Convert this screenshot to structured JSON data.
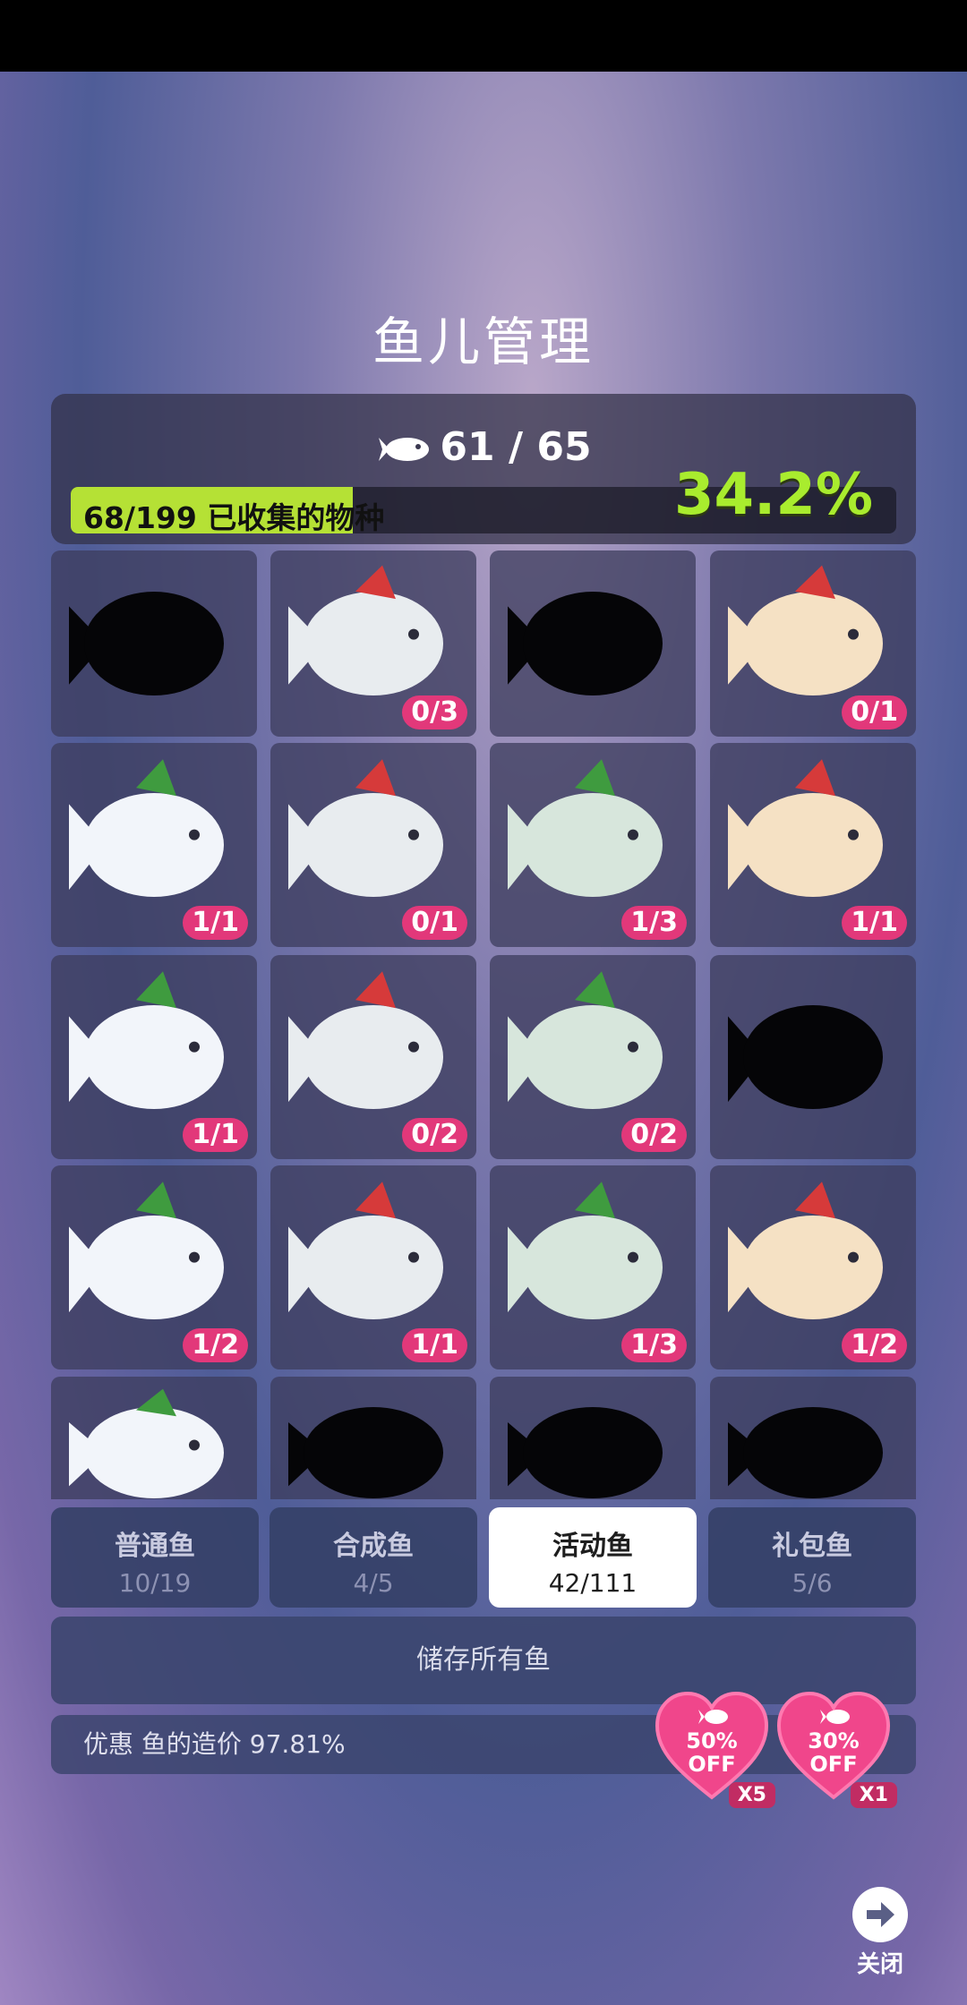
{
  "title": "鱼儿管理",
  "header": {
    "fish_count": "61 / 65",
    "collection_label": "68/199 已收集的物种",
    "collection_progress": 0.342,
    "percent": "34.2%"
  },
  "grid_items": [
    {
      "badge": "",
      "locked": true
    },
    {
      "badge": "0/3",
      "locked": false
    },
    {
      "badge": "",
      "locked": true
    },
    {
      "badge": "0/1",
      "locked": false
    },
    {
      "badge": "1/1",
      "locked": false
    },
    {
      "badge": "0/1",
      "locked": false
    },
    {
      "badge": "1/3",
      "locked": false
    },
    {
      "badge": "1/1",
      "locked": false
    },
    {
      "badge": "1/1",
      "locked": false
    },
    {
      "badge": "0/2",
      "locked": false
    },
    {
      "badge": "0/2",
      "locked": false
    },
    {
      "badge": "",
      "locked": true
    },
    {
      "badge": "1/2",
      "locked": false
    },
    {
      "badge": "1/1",
      "locked": false
    },
    {
      "badge": "1/3",
      "locked": false
    },
    {
      "badge": "1/2",
      "locked": false
    },
    {
      "badge": "",
      "locked": false
    },
    {
      "badge": "",
      "locked": true
    },
    {
      "badge": "",
      "locked": true
    },
    {
      "badge": "",
      "locked": true
    }
  ],
  "tabs": [
    {
      "label": "普通鱼",
      "count": "10/19"
    },
    {
      "label": "合成鱼",
      "count": "4/5"
    },
    {
      "label": "活动鱼",
      "count": "42/111"
    },
    {
      "label": "礼包鱼",
      "count": "5/6"
    }
  ],
  "store_all_label": "储存所有鱼",
  "discount_label": "优惠 鱼的造价 97.81%",
  "coupons": [
    {
      "text": "50% OFF",
      "line1": "50%",
      "line2": "OFF",
      "multiplier": "X5"
    },
    {
      "text": "30% OFF",
      "line1": "30%",
      "line2": "OFF",
      "multiplier": "X1"
    }
  ],
  "close_label": "关闭",
  "colors": {
    "accent_green": "#a9ec2e",
    "badge_pink": "#e2387a",
    "progress_fill": "#b5e135"
  }
}
